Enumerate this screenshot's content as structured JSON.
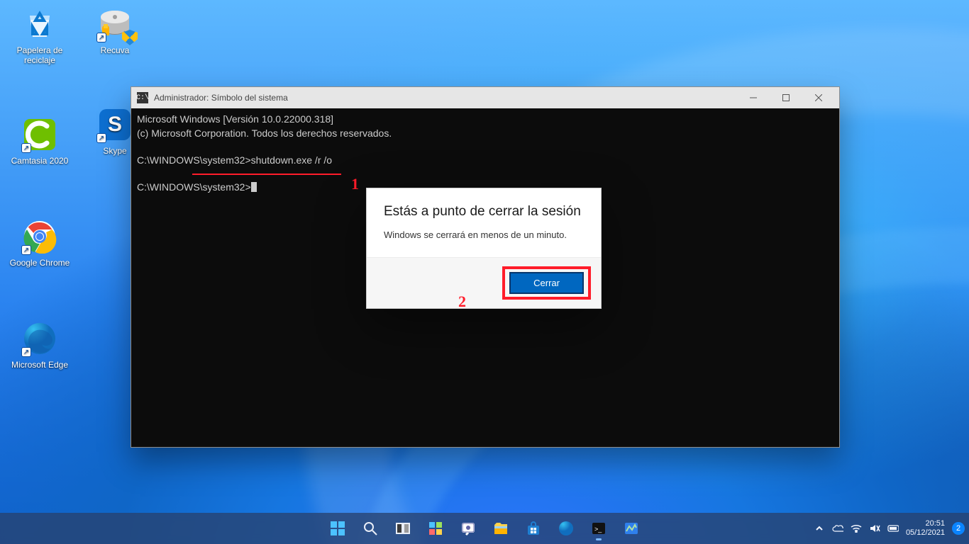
{
  "desktop_icons_col1": [
    {
      "name": "recycle-bin",
      "label": "Papelera de reciclaje"
    },
    {
      "name": "camtasia",
      "label": "Camtasia 2020"
    },
    {
      "name": "google-chrome",
      "label": "Google Chrome"
    },
    {
      "name": "microsoft-edge",
      "label": "Microsoft Edge"
    }
  ],
  "desktop_icons_col2": [
    {
      "name": "recuva",
      "label": "Recuva"
    },
    {
      "name": "skype",
      "label": "Skype"
    }
  ],
  "cmd": {
    "title": "Administrador: Símbolo del sistema",
    "line1": "Microsoft Windows [Versión 10.0.22000.318]",
    "line2": "(c) Microsoft Corporation. Todos los derechos reservados.",
    "prompt1": "C:\\WINDOWS\\system32>",
    "command": "shutdown.exe /r /o",
    "prompt2": "C:\\WINDOWS\\system32>"
  },
  "annotations": {
    "one": "1",
    "two": "2"
  },
  "dialog": {
    "title": "Estás a punto de cerrar la sesión",
    "body": "Windows se cerrará en menos de un minuto.",
    "button": "Cerrar"
  },
  "taskbar": {
    "items": [
      {
        "name": "start"
      },
      {
        "name": "search"
      },
      {
        "name": "task-view"
      },
      {
        "name": "widgets"
      },
      {
        "name": "chat"
      },
      {
        "name": "file-explorer"
      },
      {
        "name": "microsoft-store"
      },
      {
        "name": "edge"
      },
      {
        "name": "cmd",
        "active": true
      },
      {
        "name": "taskmgr"
      }
    ]
  },
  "tray": {
    "time": "20:51",
    "date": "05/12/2021",
    "notifications": "2"
  }
}
